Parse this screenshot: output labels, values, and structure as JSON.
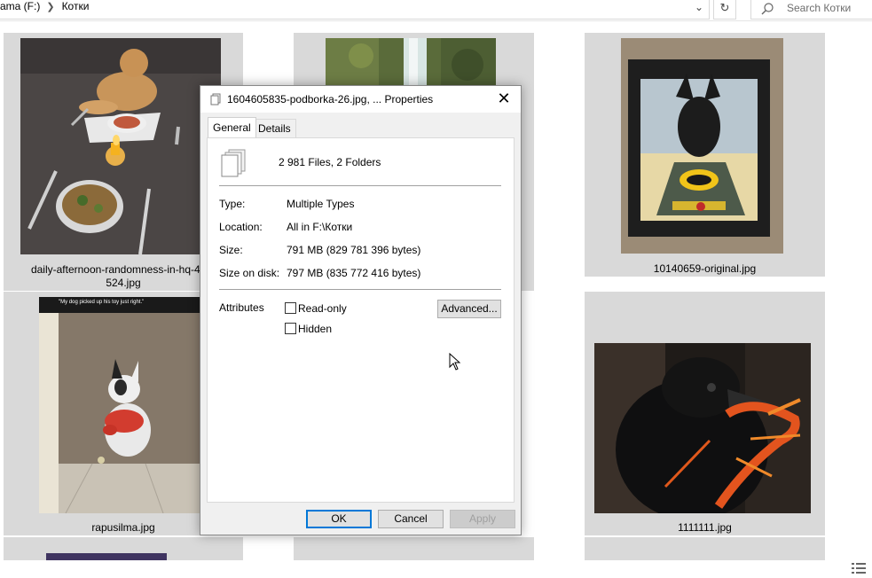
{
  "address": {
    "crumbs": [
      "ama (F:)",
      "Котки"
    ],
    "search_placeholder": "Search Котки"
  },
  "files": [
    {
      "name": "daily-afternoon-randomness-in-hq-45-photos-524.jpg",
      "caption_line1": "daily-afternoon-randomness-in-hq-45-p",
      "caption_line2": "524.jpg",
      "thumb": "dog-dinner-photo"
    },
    {
      "name": "",
      "thumb": "waterfall-photo"
    },
    {
      "name": "10140659-original.jpg",
      "caption_line1": "10140659-original.jpg",
      "thumb": "doberman-batman-photo"
    },
    {
      "name": "rapusilma.jpg",
      "caption_line1": "rapusilma.jpg",
      "thumb": "dog-toy-photo",
      "thumb_text": "\"My dog picked up his toy just right.\""
    },
    {
      "name": "1111111.jpg",
      "caption_line1": "1111111.jpg",
      "thumb": "crow-crawfish-photo"
    }
  ],
  "dialog": {
    "title": "1604605835-podborka-26.jpg, ... Properties",
    "tabs": [
      "General",
      "Details"
    ],
    "summary": "2 981 Files, 2 Folders",
    "type_label": "Type:",
    "type_value": "Multiple Types",
    "location_label": "Location:",
    "location_value": "All in F:\\Котки",
    "size_label": "Size:",
    "size_value": "791 MB (829 781 396 bytes)",
    "size_on_disk_label": "Size on disk:",
    "size_on_disk_value": "797 MB (835 772 416 bytes)",
    "attributes_label": "Attributes",
    "readonly_label": "Read-only",
    "hidden_label": "Hidden",
    "advanced_label": "Advanced...",
    "ok_label": "OK",
    "cancel_label": "Cancel",
    "apply_label": "Apply"
  },
  "colors": {
    "accent": "#0078d7",
    "tile_bg": "#d9d9d9"
  }
}
